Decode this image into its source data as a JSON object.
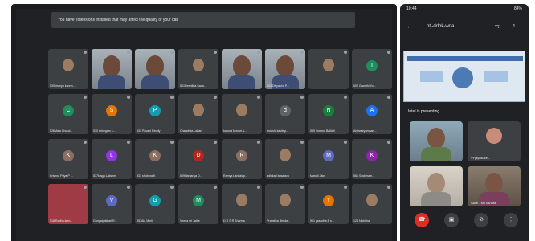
{
  "desktop": {
    "banner_text": "You have extensions installed that may affect the quality of your call",
    "rows": [
      [
        {
          "name": "53Sowmya kannn...",
          "kind": "photo"
        },
        {
          "name": "",
          "kind": "video"
        },
        {
          "name": "",
          "kind": "video"
        },
        {
          "name": "501Reenitha Sada...",
          "kind": "photo"
        },
        {
          "name": "",
          "kind": "video"
        },
        {
          "name": "503 Divyashri P...",
          "kind": "video"
        },
        {
          "name": "",
          "kind": "photo"
        },
        {
          "name": "502 Gaanthi Yo...",
          "kind": "letter",
          "letter": "T",
          "color": "#1e8e5e"
        }
      ],
      [
        {
          "name": "526Mala Choud...",
          "kind": "letter",
          "letter": "C",
          "color": "#1e8e5e"
        },
        {
          "name": "530 srinegam s...",
          "kind": "letter",
          "letter": "S",
          "color": "#e37400"
        },
        {
          "name": "533 Pavani Reddy",
          "kind": "letter",
          "letter": "P",
          "color": "#129eaf"
        },
        {
          "name": "Chandrika Lahari",
          "kind": "photo"
        },
        {
          "name": "karuna kumari A...",
          "kind": "photo"
        },
        {
          "name": "moushi kavitrtp...",
          "kind": "letter",
          "letter": "d",
          "color": "#5f6368"
        },
        {
          "name": "559 Sowmu Balliati",
          "kind": "letter",
          "letter": "N",
          "color": "#188038"
        },
        {
          "name": "Aishwaryamaan...",
          "kind": "letter",
          "letter": "A",
          "color": "#1a73e8"
        }
      ],
      [
        {
          "name": "Krishna Priya P ...",
          "kind": "letter",
          "letter": "K",
          "color": "#8d6e63"
        },
        {
          "name": "537Naga Lakshmi",
          "kind": "letter",
          "letter": "L",
          "color": "#9334e6"
        },
        {
          "name": "537 shubhra K",
          "kind": "letter",
          "letter": "K",
          "color": "#8d6e63"
        },
        {
          "name": "509Harijariya D...",
          "kind": "letter",
          "letter": "D",
          "color": "#b3261e"
        },
        {
          "name": "Ramya Lankalap...",
          "kind": "letter",
          "letter": "R",
          "color": "#8d6e63"
        },
        {
          "name": "adhikari kusalava",
          "kind": "photo"
        },
        {
          "name": "Manali Jain",
          "kind": "letter",
          "letter": "M",
          "color": "#5c6bc0"
        },
        {
          "name": "561 Sushmam...",
          "kind": "letter",
          "letter": "K",
          "color": "#8e24aa"
        }
      ],
      [
        {
          "name": "518 Radha kum...",
          "kind": "red"
        },
        {
          "name": "Gangaipakkari R...",
          "kind": "letter",
          "letter": "V",
          "color": "#5c6bc0"
        },
        {
          "name": "557Ala Murli",
          "kind": "letter",
          "letter": "G",
          "color": "#129eaf"
        },
        {
          "name": "Veena sri Jathe",
          "kind": "letter",
          "letter": "M",
          "color": "#1e8e5e"
        },
        {
          "name": "D R S R Sharma",
          "kind": "photo"
        },
        {
          "name": "Pravalika Bhuda...",
          "kind": "photo"
        },
        {
          "name": "501 yasodha B s...",
          "kind": "letter",
          "letter": "Y",
          "color": "#e37400"
        },
        {
          "name": "124 Nikhitha",
          "kind": "photo"
        }
      ]
    ]
  },
  "phone": {
    "status_time": "10:44",
    "status_right": "84%",
    "meeting_code": "otj-ddbk-wqa",
    "presenting_text": "Intel is presenting",
    "tiles": [
      {
        "name": "",
        "kind": "video"
      },
      {
        "name": "VFjayasuke...",
        "kind": "avatar"
      },
      {
        "name": "",
        "kind": "video2"
      },
      {
        "name": "Saite - My ushara",
        "kind": "video"
      }
    ],
    "controls": [
      "call-end-icon",
      "camera-icon",
      "mic-off-icon",
      "more-icon"
    ]
  }
}
